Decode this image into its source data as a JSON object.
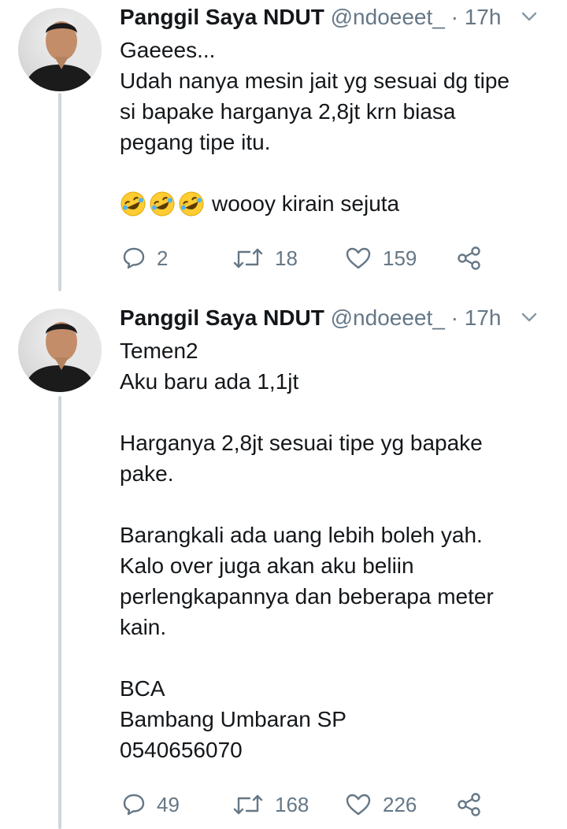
{
  "tweets": [
    {
      "author_name": "Panggil Saya NDUT",
      "handle": "@ndoeeet_",
      "separator": "·",
      "time": "17h",
      "paragraphs": [
        [
          "Gaeees...",
          "Udah nanya mesin jait yg sesuai dg tipe",
          "si bapake harganya 2,8jt krn biasa",
          "pegang tipe itu."
        ]
      ],
      "emoji_line": {
        "emoji_icon": "rolling-on-floor-laughing-emoji",
        "count": 3,
        "text": "woooy kirain sejuta"
      },
      "replies": "2",
      "retweets": "18",
      "likes": "159"
    },
    {
      "author_name": "Panggil Saya NDUT",
      "handle": "@ndoeeet_",
      "separator": "·",
      "time": "17h",
      "paragraphs": [
        [
          "Temen2",
          "Aku baru ada 1,1jt"
        ],
        [
          "Harganya 2,8jt sesuai tipe yg bapake",
          "pake."
        ],
        [
          "Barangkali ada uang lebih boleh yah.",
          "Kalo over juga akan aku beliin",
          "perlengkapannya dan beberapa meter",
          "kain."
        ],
        [
          "BCA",
          "Bambang Umbaran SP",
          "0540656070"
        ]
      ],
      "replies": "49",
      "retweets": "168",
      "likes": "226"
    }
  ],
  "icons": {
    "reply": "reply-icon",
    "retweet": "retweet-icon",
    "like": "heart-icon",
    "share": "share-icon",
    "menu": "chevron-down-icon"
  },
  "colors": {
    "text": "#14171a",
    "secondary": "#657786",
    "thread_line": "#ccd6dd",
    "background": "#ffffff"
  }
}
